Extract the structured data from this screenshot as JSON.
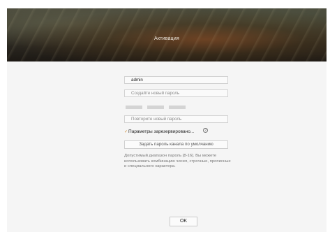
{
  "banner": {
    "title": "Активация"
  },
  "form": {
    "username_value": "admin",
    "password_placeholder": "Создайте новый пароль",
    "confirm_placeholder": "Повторите новый пароль",
    "reserved_params_label": "Параметры зарезервировано...",
    "reserved_params_checked": true,
    "help_glyph": "?",
    "default_channel_password_button": "Задать пароль канала по умолчанию",
    "password_hint": "Допустимый диапазон пароль [8-16]. Вы можете использовать комбинацию чисел, строчные, прописные и специального характера.",
    "ok_button": "OK"
  },
  "icons": {
    "checkmark": "checkmark-icon",
    "help": "help-icon"
  },
  "colors": {
    "checkmark": "#d08a2e",
    "strength_bar": "#d4d4d4"
  }
}
